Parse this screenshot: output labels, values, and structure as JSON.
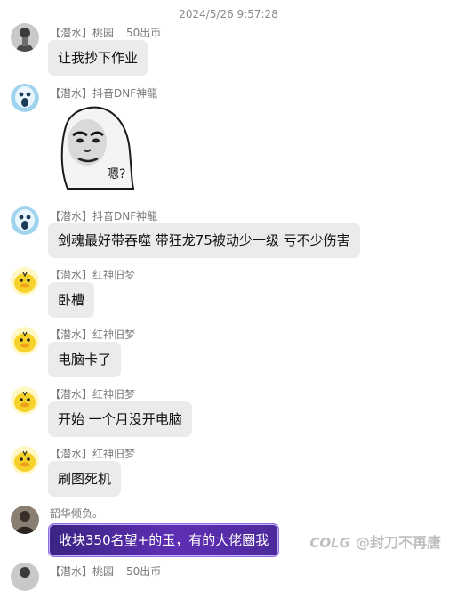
{
  "chat": {
    "timestamp": "2024/5/26 9:57:28",
    "messages": [
      {
        "tag": "【潜水】",
        "name": "桃园",
        "extra": "50出币",
        "text": "让我抄下作业",
        "avatar": "person-avatar"
      },
      {
        "tag": "【潜水】",
        "name": "抖音DNF神龍",
        "extra": "",
        "sticker_text": "嗯?",
        "avatar": "blue-ghost-avatar"
      },
      {
        "tag": "【潜水】",
        "name": "抖音DNF神龍",
        "extra": "",
        "text": "剑魂最好带吞噬 带狂龙75被动少一级 亏不少伤害",
        "avatar": "blue-ghost-avatar"
      },
      {
        "tag": "【潜水】",
        "name": "红神旧梦",
        "extra": "",
        "text": "卧槽",
        "avatar": "yellow-duck-avatar"
      },
      {
        "tag": "【潜水】",
        "name": "红神旧梦",
        "extra": "",
        "text": "电脑卡了",
        "avatar": "yellow-duck-avatar"
      },
      {
        "tag": "【潜水】",
        "name": "红神旧梦",
        "extra": "",
        "text": "开始 一个月没开电脑",
        "avatar": "yellow-duck-avatar"
      },
      {
        "tag": "【潜水】",
        "name": "红神旧梦",
        "extra": "",
        "text": "刷图死机",
        "avatar": "yellow-duck-avatar"
      },
      {
        "tag": "",
        "name": "韶华倾负。",
        "extra": "",
        "text": "收块350名望+的玉，有的大佬圈我",
        "avatar": "dark-person-avatar"
      },
      {
        "tag": "【潜水】",
        "name": "桃园",
        "extra": "50出币",
        "avatar": "person-avatar"
      }
    ]
  },
  "watermark": {
    "logo": "COLG",
    "text": "@封刀不再唐"
  }
}
